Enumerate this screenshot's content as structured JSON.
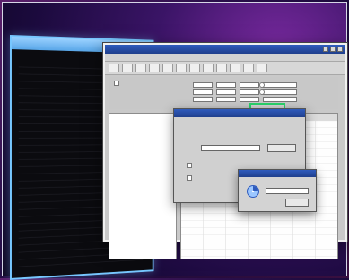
{
  "window": {
    "title": "",
    "menu": [
      "",
      "",
      "",
      "",
      "",
      "",
      ""
    ],
    "toolbar_icons": [
      "",
      "",
      "",
      "",
      "",
      "",
      "",
      "",
      "",
      "",
      "",
      ""
    ]
  },
  "top_panel": {
    "checkbox_label": "",
    "field_labels": [
      "",
      "",
      ""
    ],
    "field_values": [
      "",
      "",
      "",
      "",
      "",
      ""
    ],
    "radio_labels": [
      "",
      ""
    ]
  },
  "left_list": {
    "rows": [
      "",
      "",
      "",
      "",
      "",
      "",
      "",
      "",
      "",
      "",
      "",
      "",
      "",
      "",
      "",
      "",
      ""
    ]
  },
  "dialog": {
    "title": "",
    "section": "",
    "sublabel": "",
    "combo_value": "",
    "button_label": "",
    "option1": "",
    "option2": ""
  },
  "dialog2": {
    "title": "",
    "input_value": "",
    "ok_label": ""
  }
}
